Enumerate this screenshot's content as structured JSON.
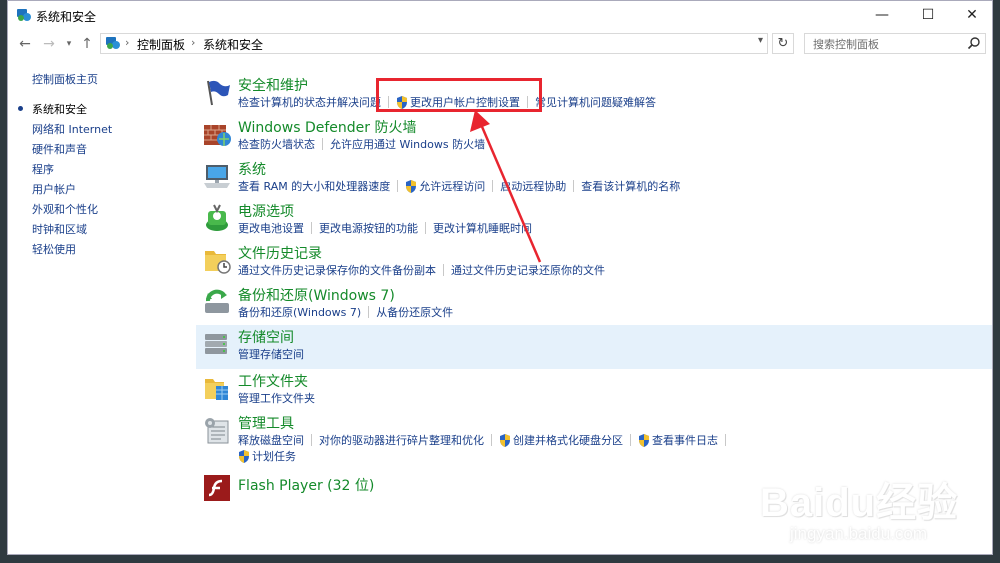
{
  "window": {
    "title": "系统和安全",
    "controls": {
      "minimize": "—",
      "maximize": "☐",
      "close": "✕"
    }
  },
  "address": {
    "crumbs": [
      "控制面板",
      "系统和安全"
    ],
    "search_placeholder": "搜索控制面板"
  },
  "sidebar": {
    "items": [
      {
        "label": "控制面板主页",
        "current": false
      },
      {
        "label": "系统和安全",
        "current": true
      },
      {
        "label": "网络和 Internet",
        "current": false
      },
      {
        "label": "硬件和声音",
        "current": false
      },
      {
        "label": "程序",
        "current": false
      },
      {
        "label": "用户帐户",
        "current": false
      },
      {
        "label": "外观和个性化",
        "current": false
      },
      {
        "label": "时钟和区域",
        "current": false
      },
      {
        "label": "轻松使用",
        "current": false
      }
    ]
  },
  "categories": [
    {
      "title": "安全和维护",
      "icon": "flag-icon",
      "links": [
        "检查计算机的状态并解决问题",
        "更改用户帐户控制设置",
        "常见计算机问题疑难解答"
      ]
    },
    {
      "title": "Windows Defender 防火墙",
      "icon": "firewall-icon",
      "links": [
        "检查防火墙状态",
        "允许应用通过 Windows 防火墙"
      ]
    },
    {
      "title": "系统",
      "icon": "computer-icon",
      "links": [
        "查看 RAM 的大小和处理器速度",
        "允许远程访问",
        "启动远程协助",
        "查看该计算机的名称"
      ]
    },
    {
      "title": "电源选项",
      "icon": "power-icon",
      "links": [
        "更改电池设置",
        "更改电源按钮的功能",
        "更改计算机睡眠时间"
      ]
    },
    {
      "title": "文件历史记录",
      "icon": "file-history-icon",
      "links": [
        "通过文件历史记录保存你的文件备份副本",
        "通过文件历史记录还原你的文件"
      ]
    },
    {
      "title": "备份和还原(Windows 7)",
      "icon": "backup-icon",
      "links": [
        "备份和还原(Windows 7)",
        "从备份还原文件"
      ]
    },
    {
      "title": "存储空间",
      "icon": "storage-icon",
      "links": [
        "管理存储空间"
      ]
    },
    {
      "title": "工作文件夹",
      "icon": "work-folders-icon",
      "links": [
        "管理工作文件夹"
      ]
    },
    {
      "title": "管理工具",
      "icon": "admin-tools-icon",
      "links": [
        "释放磁盘空间",
        "对你的驱动器进行碎片整理和优化",
        "创建并格式化硬盘分区",
        "查看事件日志",
        "计划任务"
      ]
    },
    {
      "title": "Flash Player (32 位)",
      "icon": "flash-icon",
      "links": []
    }
  ],
  "watermark": {
    "brand": "Baidu经验",
    "url": "jingyan.baidu.com"
  },
  "colors": {
    "category_title": "#148a2a",
    "link": "#1a3f8a",
    "annotation": "#e8252f",
    "highlight": "#e5f1fb"
  }
}
